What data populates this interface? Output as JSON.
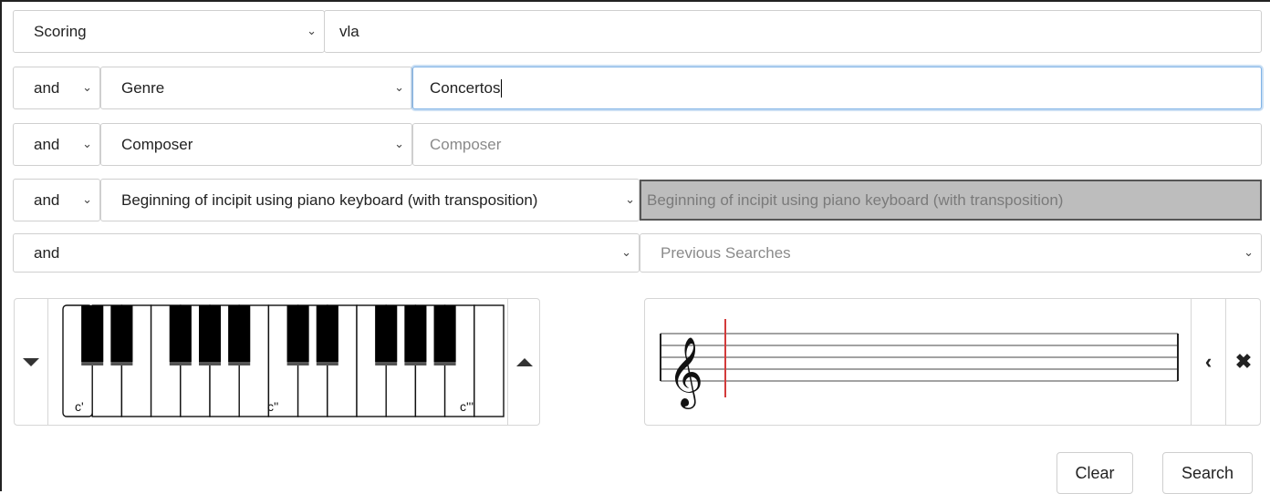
{
  "rows": [
    {
      "field": "Scoring",
      "value": "vla"
    },
    {
      "op": "and",
      "field": "Genre",
      "value": "Concertos"
    },
    {
      "op": "and",
      "field": "Composer",
      "placeholder": "Composer"
    },
    {
      "op": "and",
      "field": "Beginning of incipit using piano keyboard (with transposition)",
      "placeholder": "Beginning of incipit using piano keyboard (with transposition)"
    },
    {
      "op": "and",
      "previous": "Previous Searches"
    }
  ],
  "keyboard": {
    "labels": [
      "c'",
      "c''",
      "c'''"
    ]
  },
  "buttons": {
    "clear": "Clear",
    "search": "Search"
  },
  "icons": {
    "chevron": "chevron-down-icon",
    "down": "triangle-down-icon",
    "up": "triangle-up-icon",
    "back": "chevron-left-icon",
    "close": "close-icon"
  },
  "colors": {
    "focus": "#66a3e0",
    "cursor_line": "#d33b3b",
    "disabled_bg": "#bdbdbd"
  }
}
